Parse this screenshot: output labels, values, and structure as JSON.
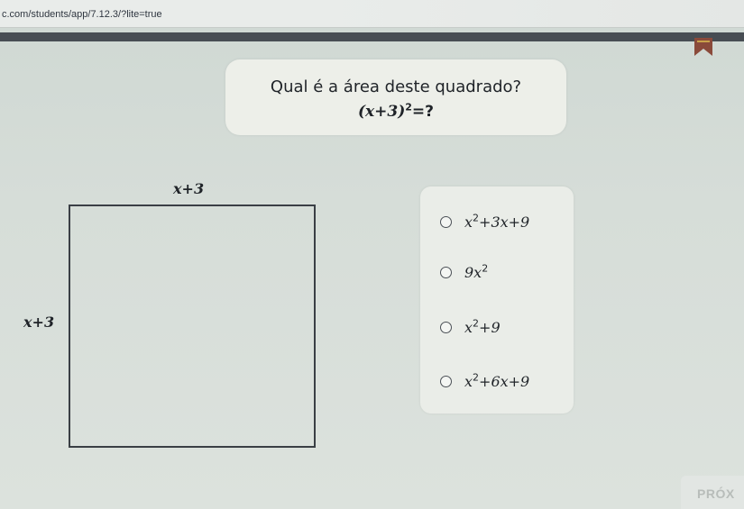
{
  "browser": {
    "url": "c.com/students/app/7.12.3/?lite=true"
  },
  "question": {
    "title": "Qual é a área deste quadrado?",
    "expr_base": "(x+3)",
    "expr_exp": "2",
    "expr_tail": "=?"
  },
  "figure": {
    "side_top": "x+3",
    "side_left": "x+3"
  },
  "options": [
    {
      "id": "a",
      "pre": "x",
      "exp": "2",
      "post": "+3x+9",
      "selected": false
    },
    {
      "id": "b",
      "pre": "9x",
      "exp": "2",
      "post": "",
      "selected": false
    },
    {
      "id": "c",
      "pre": "x",
      "exp": "2",
      "post": "+9",
      "selected": false
    },
    {
      "id": "d",
      "pre": "x",
      "exp": "2",
      "post": "+6x+9",
      "selected": false
    }
  ],
  "footer": {
    "next_label": "PRÓX"
  },
  "icons": {
    "bookmark": "bookmark-icon",
    "radio": "radio-circle-icon"
  },
  "colors": {
    "header_strip": "#474d53",
    "bookmark": "#8a4a3a",
    "panel": "#edefe9"
  }
}
